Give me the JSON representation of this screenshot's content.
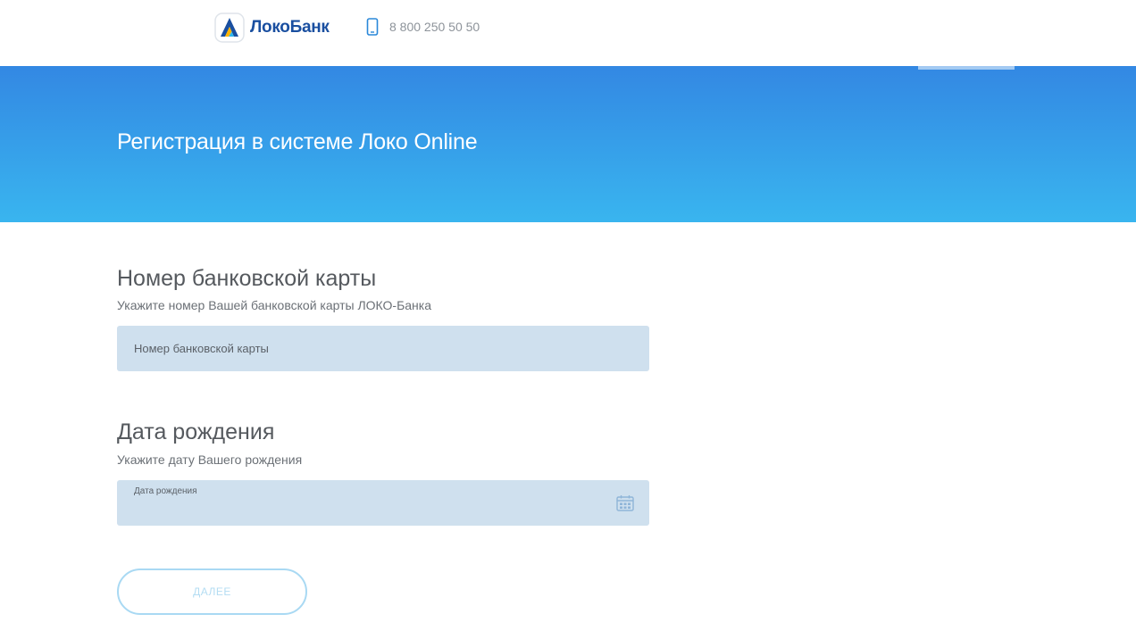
{
  "header": {
    "logo_text": "ЛокоБанк",
    "phone": "8 800 250 50 50"
  },
  "banner": {
    "title": "Регистрация в системе Локо Online"
  },
  "card_section": {
    "title": "Номер банковской карты",
    "subtitle": "Укажите номер Вашей банковской карты ЛОКО-Банка",
    "input_placeholder": "Номер банковской карты",
    "input_value": ""
  },
  "birth_section": {
    "title": "Дата рождения",
    "subtitle": "Укажите дату Вашего рождения",
    "input_label": "Дата рождения",
    "input_value": ""
  },
  "next_button": {
    "label": "ДАЛЕЕ"
  },
  "colors": {
    "brand_blue": "#1a4fa0",
    "banner_top": "#3388e3",
    "banner_bottom": "#39b5ef",
    "field_bg": "#cfe0ee",
    "button_border": "#a9d9f3"
  },
  "icons": {
    "logo": "lokobank-logo-icon",
    "phone": "mobile-phone-icon",
    "calendar": "calendar-icon"
  }
}
